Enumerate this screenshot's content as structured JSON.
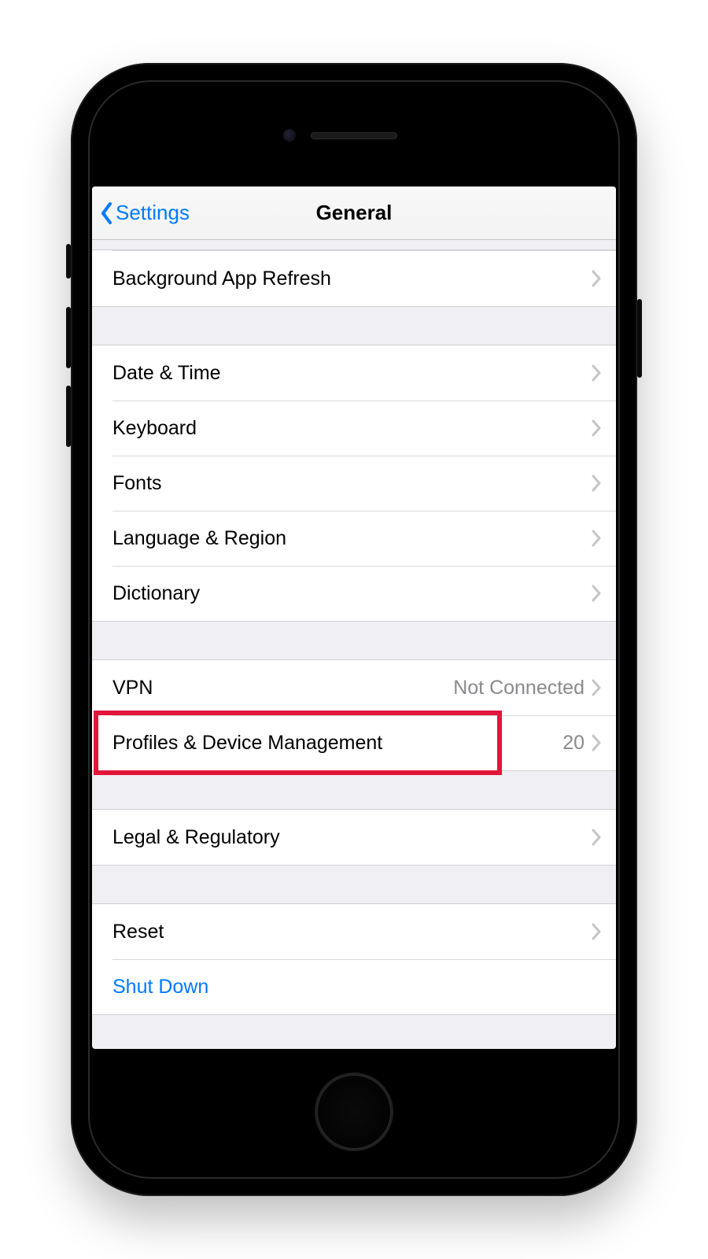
{
  "navbar": {
    "back_label": "Settings",
    "title": "General"
  },
  "groups": [
    {
      "gap": "small",
      "rows": [
        {
          "name": "background-app-refresh",
          "label": "Background App Refresh",
          "chevron": true
        }
      ]
    },
    {
      "gap": "normal",
      "rows": [
        {
          "name": "date-time",
          "label": "Date & Time",
          "chevron": true
        },
        {
          "name": "keyboard",
          "label": "Keyboard",
          "chevron": true
        },
        {
          "name": "fonts",
          "label": "Fonts",
          "chevron": true
        },
        {
          "name": "language-region",
          "label": "Language & Region",
          "chevron": true
        },
        {
          "name": "dictionary",
          "label": "Dictionary",
          "chevron": true
        }
      ]
    },
    {
      "gap": "normal",
      "rows": [
        {
          "name": "vpn",
          "label": "VPN",
          "value": "Not Connected",
          "chevron": true
        },
        {
          "name": "profiles-device-management",
          "label": "Profiles & Device Management",
          "value": "20",
          "chevron": true
        }
      ]
    },
    {
      "gap": "normal",
      "rows": [
        {
          "name": "legal-regulatory",
          "label": "Legal & Regulatory",
          "chevron": true
        }
      ]
    },
    {
      "gap": "normal",
      "rows": [
        {
          "name": "reset",
          "label": "Reset",
          "chevron": true
        },
        {
          "name": "shut-down",
          "label": "Shut Down",
          "link": true,
          "chevron": false
        }
      ]
    }
  ],
  "annotation": {
    "highlight_row": "profiles-device-management",
    "color": "#e2163a"
  }
}
